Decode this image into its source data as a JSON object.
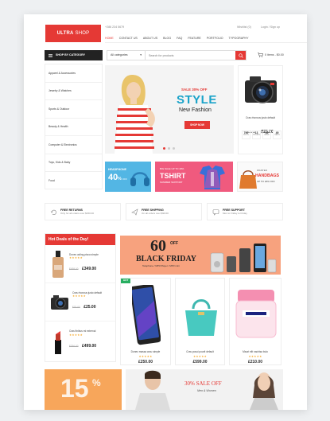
{
  "topbar": {
    "phone": "+286 234 5679",
    "wishlist": "Wishlist (0)",
    "account": "Login / Sign up"
  },
  "logo": {
    "brand": "ULTRA",
    "suffix": "SHOP"
  },
  "nav": [
    "HOME",
    "CONTACT US",
    "ABOUT US",
    "BLOG",
    "FAQ",
    "FEATURE",
    "PORTFOLIO",
    "TYPOGRAPHY"
  ],
  "category_bar": {
    "label": "SHOP BY CATEGORY"
  },
  "search": {
    "category": "All categories",
    "placeholder": "Search for products"
  },
  "cart": {
    "label": "0 items - $0.00"
  },
  "sidebar": [
    "Apparel & Accessories",
    "Jewelry & Watches",
    "Sports & Outdoor",
    "Beauty & Health",
    "Computer & Electronics",
    "Toys, Kids & Baby",
    "Food"
  ],
  "hero": {
    "sale": "SALE 30% OFF",
    "headline": "STYLE",
    "sub": "New Fashion",
    "cta": "SHOP NOW"
  },
  "camera_card": {
    "name": "Cras rhoncus justo default",
    "old_price": "$70.00",
    "price": "$25.00",
    "countdown": [
      {
        "value": "790",
        "unit": "DAYS"
      },
      {
        "value": "13",
        "unit": "HOURS"
      },
      {
        "value": "12",
        "unit": "MINS"
      },
      {
        "value": "49",
        "unit": "SECS"
      }
    ]
  },
  "banners": {
    "headphone": {
      "title": "HEADPHONE",
      "discount": "40",
      "pct": "%",
      "off": "OFF"
    },
    "tshirt": {
      "line1": "BIG SALE UP TO 40%",
      "line2": "TSHIRT",
      "line3": "SUMMER SUPPORT"
    },
    "handbags": {
      "line1": "WANTED",
      "line2": "HANDBAGS",
      "line3": "UP TO 20% OFF"
    }
  },
  "features": [
    {
      "title": "FREE RETURNS",
      "sub": "Only for all orders over $150.00"
    },
    {
      "title": "FREE SHIPPING",
      "sub": "On all orders over $90.00"
    },
    {
      "title": "FREE SUPPORT",
      "sub": "Mon to Friday to Friday"
    }
  ],
  "hot_deals": {
    "title": "Hot Deals of the Day!",
    "items": [
      {
        "name": "Donec acling pisca simple",
        "old": "$499.00",
        "price": "£349.00"
      },
      {
        "name": "Cras rhoncus justo default",
        "old": "$70.00",
        "price": "£25.00"
      },
      {
        "name": "Cras finibus mi external",
        "old": "$790.00",
        "price": "£499.00"
      }
    ]
  },
  "black_friday": {
    "pct": "60",
    "off": "OFF",
    "title": "BLACK FRIDAY",
    "sub": "Telephone / MP3 Player / MP3 mini"
  },
  "products": [
    {
      "badge": "HOT",
      "name": "Donec massa arcu simple",
      "price": "£250.00"
    },
    {
      "name": "Cras posui pourit default",
      "price": "£599.00"
    },
    {
      "name": "Mauri elit nachisa bulo",
      "price": "£210.00"
    }
  ],
  "bottom": {
    "left": {
      "big": "15",
      "pct": "%"
    },
    "right": {
      "line1": "30% SALE OFF",
      "line2": "Men & Women"
    }
  },
  "colors": {
    "accent": "#e53935",
    "teal": "#1aa3c9"
  }
}
